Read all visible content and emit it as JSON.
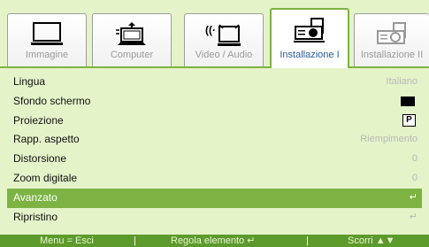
{
  "tabs": [
    {
      "label": "Immagine",
      "icon": "monitor-icon",
      "active": false
    },
    {
      "label": "Computer",
      "icon": "computer-icon",
      "active": false
    },
    {
      "label": "Video / Audio",
      "icon": "video-audio-icon",
      "active": false
    },
    {
      "label": "Installazione I",
      "icon": "projector-icon",
      "active": true
    },
    {
      "label": "Installazione II",
      "icon": "projector-settings-icon",
      "active": false
    }
  ],
  "menu": [
    {
      "label": "Lingua",
      "value": "Italiano"
    },
    {
      "label": "Sfondo schermo",
      "value": ""
    },
    {
      "label": "Proiezione",
      "value": "P"
    },
    {
      "label": "Rapp. aspetto",
      "value": "Riempimento"
    },
    {
      "label": "Distorsione",
      "value": "0"
    },
    {
      "label": "Zoom digitale",
      "value": "0"
    },
    {
      "label": "Avanzato",
      "value": "↵"
    },
    {
      "label": "Ripristino",
      "value": "↵"
    }
  ],
  "selected_index": 6,
  "footer": {
    "menu_exit": "Menu = Esci",
    "adjust": "Regola elemento ↵",
    "scroll": "Scorri ▲▼"
  },
  "colors": {
    "accent": "#7cb342",
    "background": "#e5f3c9",
    "footer": "#5d9a2c",
    "active_tab_text": "#2a5a9e"
  }
}
